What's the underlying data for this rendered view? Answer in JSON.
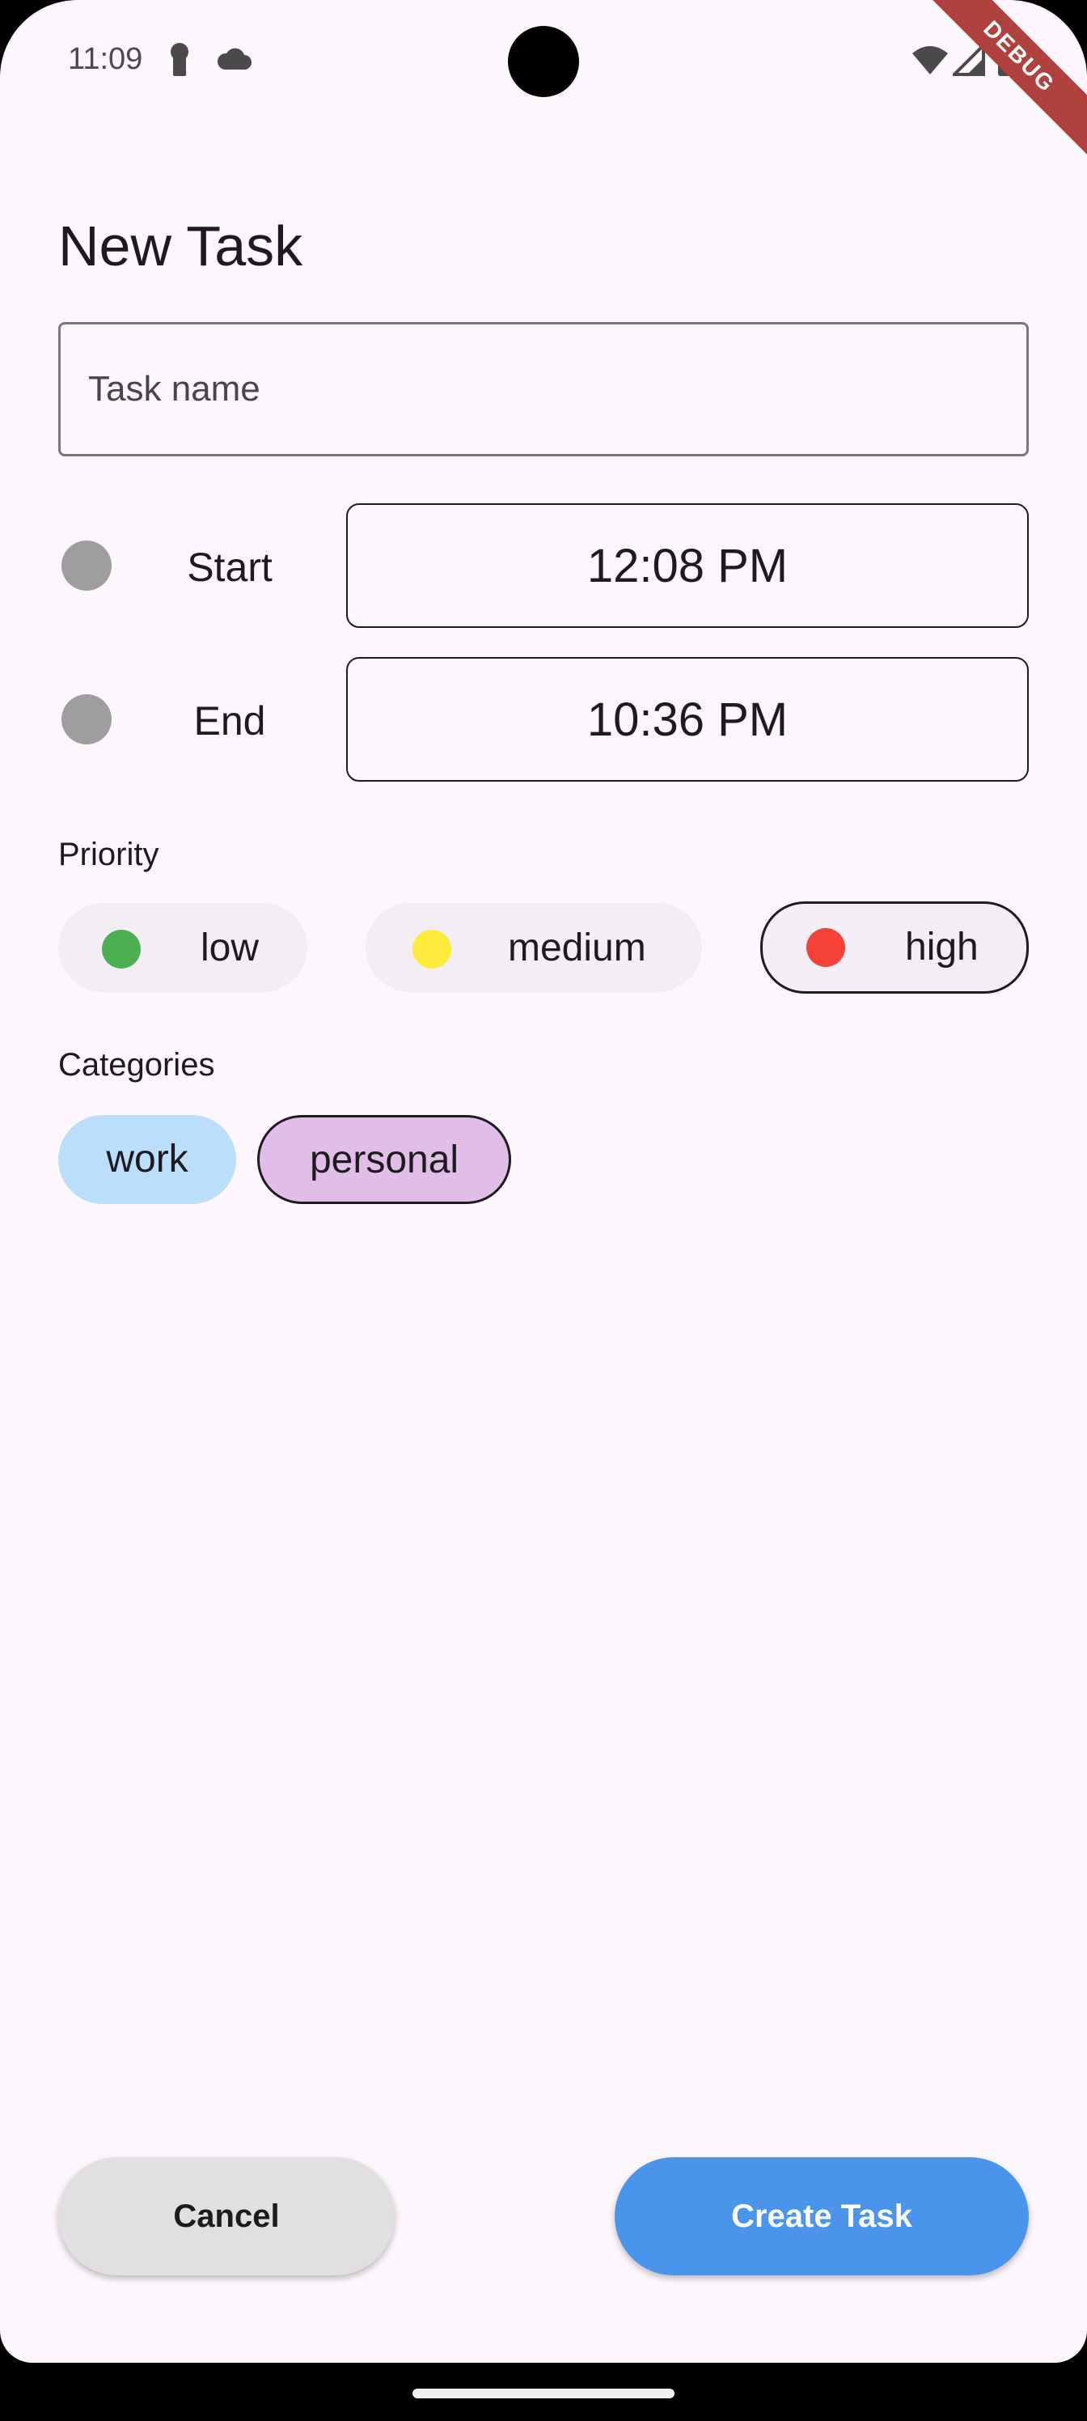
{
  "status_bar": {
    "time": "11:09",
    "debug_label": "DEBUG"
  },
  "page": {
    "title": "New Task"
  },
  "task_name": {
    "value": "",
    "placeholder": "Task name"
  },
  "schedule": {
    "start": {
      "label": "Start",
      "time": "12:08 PM"
    },
    "end": {
      "label": "End",
      "time": "10:36 PM"
    }
  },
  "priority": {
    "label": "Priority",
    "options": [
      {
        "label": "low",
        "color": "#4caf50",
        "selected": false
      },
      {
        "label": "medium",
        "color": "#ffeb3b",
        "selected": false
      },
      {
        "label": "high",
        "color": "#f44336",
        "selected": true
      }
    ]
  },
  "categories": {
    "label": "Categories",
    "options": [
      {
        "label": "work",
        "color": "#bbdefb",
        "selected": false
      },
      {
        "label": "personal",
        "color": "#e1bee7",
        "selected": true
      }
    ]
  },
  "actions": {
    "cancel_label": "Cancel",
    "create_label": "Create Task"
  },
  "colors": {
    "background": "#fdf7fd",
    "accent": "#4a95ea",
    "time_dot": "#9e9e9e"
  }
}
